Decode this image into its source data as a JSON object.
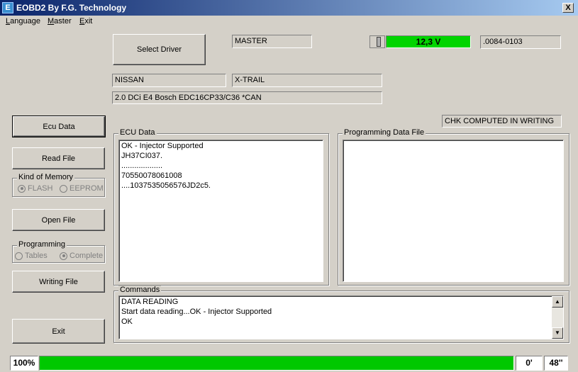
{
  "window": {
    "title": "EOBD2 By F.G. Technology",
    "icon_glyph": "E",
    "close_glyph": "X"
  },
  "menu": [
    {
      "label": "Language",
      "accel": "L",
      "rest": "anguage"
    },
    {
      "label": "Master",
      "accel": "M",
      "rest": "aster"
    },
    {
      "label": "Exit",
      "accel": "E",
      "rest": "xit"
    }
  ],
  "header": {
    "select_driver_label": "Select Driver",
    "mode_value": "MASTER",
    "voltage_value": "12,3 V",
    "version_value": ".0084-0103",
    "make_value": "NISSAN",
    "model_value": "X-TRAIL",
    "engine_value": "2.0  DCi E4 Bosch EDC16CP33/C36 *CAN",
    "checksum_status": "CHK COMPUTED IN WRITING"
  },
  "left_panel": {
    "ecu_data_label": "Ecu Data",
    "read_file_label": "Read File",
    "memory_group": {
      "title": "Kind of Memory",
      "options": [
        {
          "label": "FLASH",
          "checked": true
        },
        {
          "label": "EEPROM",
          "checked": false
        }
      ]
    },
    "open_file_label": "Open File",
    "programming_group": {
      "title": "Programming",
      "options": [
        {
          "label": "Tables",
          "checked": false
        },
        {
          "label": "Complete",
          "checked": true
        }
      ]
    },
    "writing_file_label": "Writing File",
    "exit_label": "Exit"
  },
  "ecu_data": {
    "title": "ECU Data",
    "lines": [
      "OK - Injector Supported",
      "JH37CI037.",
      "...................",
      "70550078061008",
      " ....1037535056576JD2c5."
    ]
  },
  "programming_file": {
    "title": "Programming Data File",
    "lines": []
  },
  "commands": {
    "title": "Commands",
    "lines": [
      "DATA READING",
      "Start data reading...OK - Injector Supported",
      "OK"
    ],
    "scroll_up_glyph": "▲",
    "scroll_down_glyph": "▼"
  },
  "status_bar": {
    "percent_label": "100%",
    "progress": 1.0,
    "minutes_label": "0'",
    "seconds_label": "48''"
  },
  "colors": {
    "voltage_fill": "#00d400",
    "progress_fill": "#00c800",
    "titlebar_start": "#0a246a"
  }
}
